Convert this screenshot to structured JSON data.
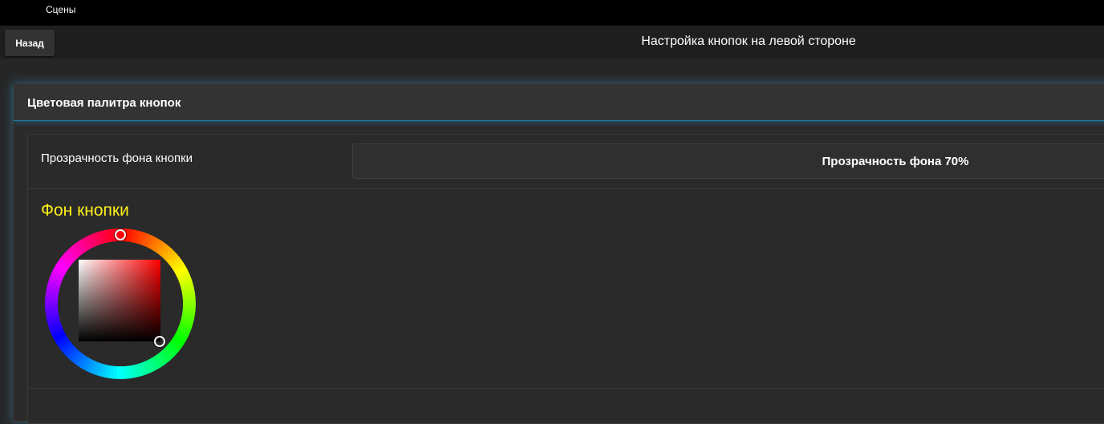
{
  "topbar": {
    "tab_label": "Сцены"
  },
  "header": {
    "back_label": "Назад",
    "title": "Настройка кнопок на левой стороне"
  },
  "panel": {
    "title": "Цветовая палитра кнопок"
  },
  "opacity": {
    "label": "Прозрачность фона кнопки",
    "value_text": "Прозрачность фона 70%"
  },
  "button_background": {
    "title": "Фон кнопки",
    "title_color": "#ffef1a",
    "selected_hue": 0,
    "shade_saturation": 0.99,
    "shade_value": 0.0
  },
  "colors": {
    "glow": "#4696be",
    "background": "#262626",
    "topbar": "#000000"
  }
}
